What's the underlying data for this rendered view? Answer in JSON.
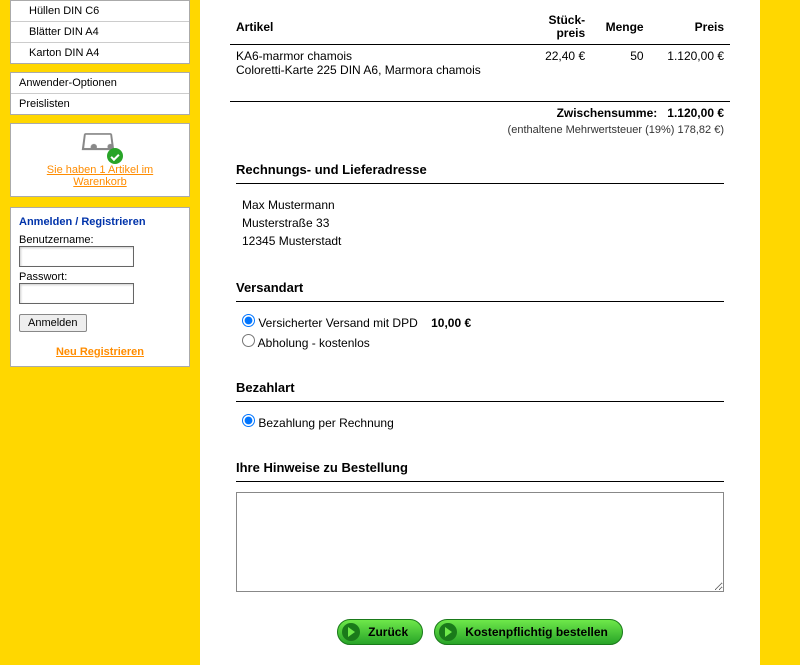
{
  "sidebar": {
    "nav": [
      "Hüllen DIN C6",
      "Blätter DIN A4",
      "Karton DIN A4"
    ],
    "nav2": [
      "Anwender-Optionen",
      "Preislisten"
    ],
    "cart_link": "Sie haben 1 Artikel im Warenkorb",
    "login": {
      "header": "Anmelden / Registrieren",
      "user_label": "Benutzername:",
      "pass_label": "Passwort:",
      "submit": "Anmelden",
      "register": "Neu Registrieren"
    }
  },
  "table": {
    "h_article": "Artikel",
    "h_unit1": "Stück-",
    "h_unit2": "preis",
    "h_qty": "Menge",
    "h_price": "Preis",
    "item_code": "KA6-marmor chamois",
    "item_desc": "Coloretti-Karte 225 DIN A6, Marmora chamois",
    "unit_price": "22,40 €",
    "qty": "50",
    "line_price": "1.120,00 €",
    "subtotal_label": "Zwischensumme:",
    "subtotal": "1.120,00 €",
    "tax": "(enthaltene Mehrwertsteuer (19%) 178,82 €)"
  },
  "address": {
    "header": "Rechnungs- und Lieferadresse",
    "name": "Max Mustermann",
    "street": "Musterstraße 33",
    "city": "12345 Musterstadt"
  },
  "shipping": {
    "header": "Versandart",
    "opt1": "Versicherter Versand mit DPD",
    "opt1_price": "10,00 €",
    "opt2": "Abholung - kostenlos"
  },
  "payment": {
    "header": "Bezahlart",
    "opt1": "Bezahlung per Rechnung"
  },
  "notes": {
    "header": "Ihre Hinweise zu Bestellung"
  },
  "buttons": {
    "back": "Zurück",
    "order": "Kostenpflichtig bestellen"
  }
}
